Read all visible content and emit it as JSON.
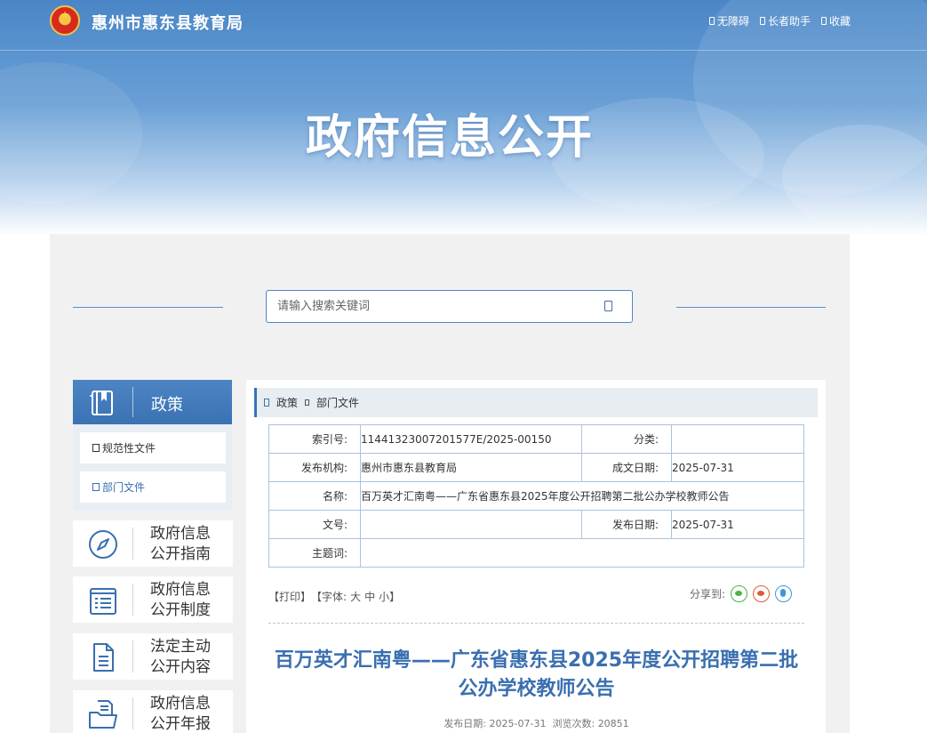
{
  "header": {
    "site_name": "惠州市惠东县教育局",
    "links": [
      {
        "label": "无障碍"
      },
      {
        "label": "长者助手"
      },
      {
        "label": "收藏"
      }
    ],
    "hero_title": "政府信息公开"
  },
  "search": {
    "placeholder": "请输入搜索关键词"
  },
  "sidebar": {
    "policy": {
      "title": "政策",
      "items": [
        {
          "label": "规范性文件"
        },
        {
          "label": "部门文件"
        }
      ]
    },
    "menu": [
      {
        "label": "政府信息公开指南"
      },
      {
        "label": "政府信息公开制度"
      },
      {
        "label": "法定主动公开内容"
      },
      {
        "label": "政府信息公开年报"
      }
    ]
  },
  "breadcrumb": {
    "level1": "政策",
    "level2": "部门文件"
  },
  "meta": {
    "index_label": "索引号:",
    "index_value": "11441323007201577E/2025-00150",
    "category_label": "分类:",
    "category_value": "",
    "publisher_label": "发布机构:",
    "publisher_value": "惠州市惠东县教育局",
    "created_label": "成文日期:",
    "created_value": "2025-07-31",
    "name_label": "名称:",
    "name_value": "百万英才汇南粤——广东省惠东县2025年度公开招聘第二批公办学校教师公告",
    "docno_label": "文号:",
    "docno_value": "",
    "published_label": "发布日期:",
    "published_value": "2025-07-31",
    "keywords_label": "主题词:",
    "keywords_value": ""
  },
  "tools": {
    "print": "【打印】",
    "font_prefix": "【字体:",
    "font_large": "大",
    "font_medium": "中",
    "font_small": "小",
    "font_suffix": "】",
    "share_label": "分享到:"
  },
  "article": {
    "title": "百万英才汇南粤——广东省惠东县2025年度公开招聘第二批公办学校教师公告",
    "date_label": "发布日期:",
    "date_value": "2025-07-31",
    "views_label": "浏览次数:",
    "views_value": "20851"
  },
  "colors": {
    "brand_blue": "#3a72b3",
    "title_blue": "#3a6fb0",
    "table_border": "#a8c4e0"
  }
}
